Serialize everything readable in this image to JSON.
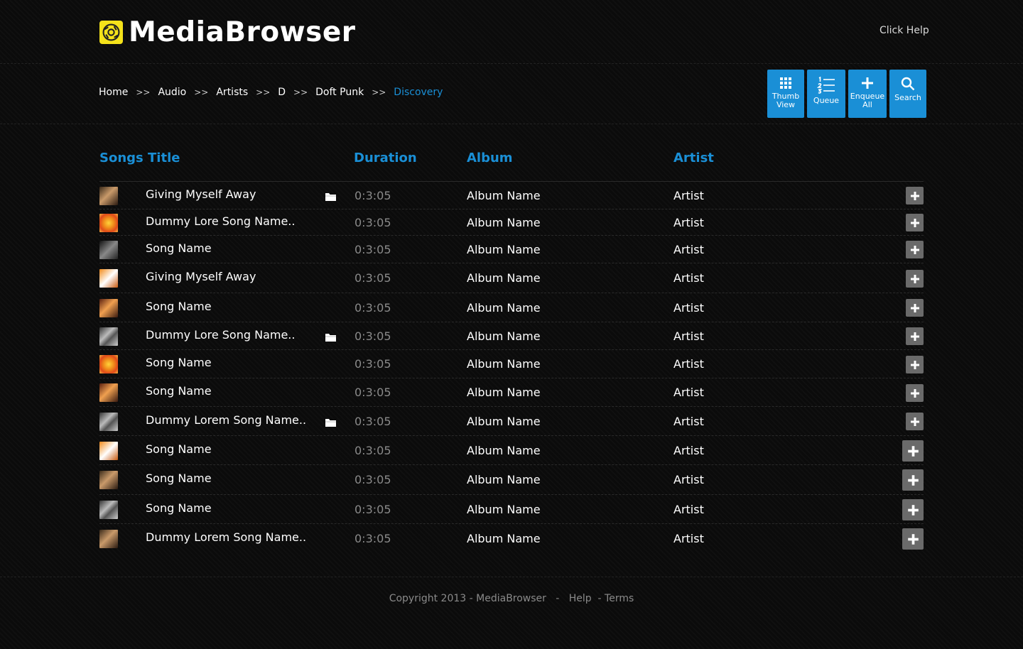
{
  "header": {
    "logo_text": "MediaBrowser",
    "help_link": "Click Help"
  },
  "breadcrumb": {
    "items": [
      "Home",
      "Audio",
      "Artists",
      "D",
      "Doft Punk"
    ],
    "current": "Discovery",
    "separator": ">>"
  },
  "toolbar": {
    "thumb_view": "Thumb View",
    "queue": "Queue",
    "enqueue_all": "Enqueue All",
    "search": "Search"
  },
  "columns": {
    "title": "Songs Title",
    "duration": "Duration",
    "album": "Album",
    "artist": "Artist"
  },
  "songs": [
    {
      "title": "Giving Myself Away",
      "duration": "0:3:05",
      "album": "Album Name",
      "artist": "Artist",
      "has_folder": true
    },
    {
      "title": "Dummy Lore Song Name..",
      "duration": "0:3:05",
      "album": "Album Name",
      "artist": "Artist",
      "has_folder": false
    },
    {
      "title": "Song Name",
      "duration": "0:3:05",
      "album": "Album Name",
      "artist": "Artist",
      "has_folder": false
    },
    {
      "title": "Giving Myself Away",
      "duration": "0:3:05",
      "album": "Album Name",
      "artist": "Artist",
      "has_folder": false
    },
    {
      "title": "Song Name",
      "duration": "0:3:05",
      "album": "Album Name",
      "artist": "Artist",
      "has_folder": false
    },
    {
      "title": "Dummy Lore Song Name..",
      "duration": "0:3:05",
      "album": "Album Name",
      "artist": "Artist",
      "has_folder": true
    },
    {
      "title": "Song Name",
      "duration": "0:3:05",
      "album": "Album Name",
      "artist": "Artist",
      "has_folder": false
    },
    {
      "title": "Song Name",
      "duration": "0:3:05",
      "album": "Album Name",
      "artist": "Artist",
      "has_folder": false
    },
    {
      "title": "Dummy Lorem Song Name..",
      "duration": "0:3:05",
      "album": "Album Name",
      "artist": "Artist",
      "has_folder": true
    },
    {
      "title": "Song Name",
      "duration": "0:3:05",
      "album": "Album Name",
      "artist": "Artist",
      "has_folder": false
    },
    {
      "title": "Song Name",
      "duration": "0:3:05",
      "album": "Album Name",
      "artist": "Artist",
      "has_folder": false
    },
    {
      "title": "Song Name",
      "duration": "0:3:05",
      "album": "Album Name",
      "artist": "Artist",
      "has_folder": false
    },
    {
      "title": "Dummy Lorem Song Name..",
      "duration": "0:3:05",
      "album": "Album Name",
      "artist": "Artist",
      "has_folder": false
    }
  ],
  "footer": {
    "copyright": "Copyright 2013 - MediaBrowser",
    "sep1": "-",
    "help": "Help",
    "sep2": "-",
    "terms": "Terms"
  },
  "colors": {
    "accent": "#1a8fd6",
    "logo_yellow": "#f4e21a",
    "background": "#0b0b0b",
    "add_button": "#6a6a6a",
    "muted_text": "#8a8a8a"
  },
  "icons": {
    "logo": "media-logo-icon",
    "thumb_view": "grid-icon",
    "queue": "numbered-list-icon",
    "enqueue_all": "plus-icon",
    "search": "search-icon",
    "folder": "folder-icon",
    "add": "plus-icon"
  }
}
